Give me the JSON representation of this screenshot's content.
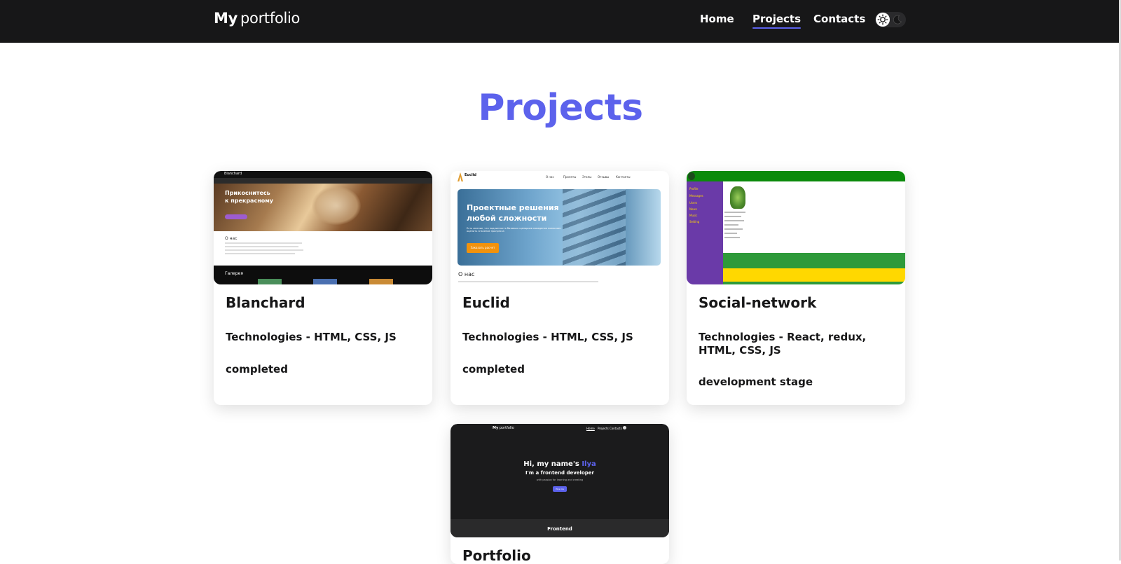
{
  "header": {
    "logo_bold": "My",
    "logo_light": "portfolio",
    "nav": [
      {
        "label": "Home",
        "active": false
      },
      {
        "label": "Projects",
        "active": true
      },
      {
        "label": "Contacts",
        "active": false
      }
    ],
    "theme_toggle": {
      "icons": [
        "sun-icon",
        "moon-icon"
      ],
      "state": "light"
    }
  },
  "main": {
    "title": "Projects",
    "projects": [
      {
        "title": "Blanchard",
        "technologies": "Technologies - HTML, CSS, JS",
        "status": "completed",
        "preview": {
          "brand": "Blanchard",
          "hero_line1": "Прикоснитесь",
          "hero_line2": "к прекрасному",
          "about": "О нас",
          "gallery": "Галерея"
        }
      },
      {
        "title": "Euclid",
        "technologies": "Technologies - HTML, CSS, JS",
        "status": "completed",
        "preview": {
          "brand": "Euclid",
          "nav": [
            "О нас",
            "Проекты",
            "Этапы",
            "Отзывы",
            "Контакты"
          ],
          "hero_line1": "Проектные решения",
          "hero_line2": "любой сложности",
          "hero_sub": "Есть мнение, что подлинность базовых сценариев поведения позволяет оценить значение прогресса",
          "cta": "Заказать расчет",
          "about": "О нас"
        }
      },
      {
        "title": "Social-network",
        "technologies": "Technologies - React, redux, HTML, CSS, JS",
        "status": "development stage",
        "preview": {
          "sidebar": [
            "Profile",
            "Messages",
            "Users",
            "News",
            "Music",
            "Setting"
          ]
        }
      },
      {
        "title": "Portfolio",
        "preview": {
          "logo_bold": "My",
          "logo_light": "portfolio",
          "nav": [
            "Home",
            "Projects",
            "Contacts"
          ],
          "greeting": "Hi, my name's",
          "name": "Ilya",
          "role": "I'm a frontend developer",
          "tagline": "with passion for learning and creating",
          "button": "Hire me",
          "section": "Frontend"
        }
      }
    ]
  },
  "colors": {
    "header_bg": "#171718",
    "accent": "#5c62ec",
    "text": "#171718"
  }
}
